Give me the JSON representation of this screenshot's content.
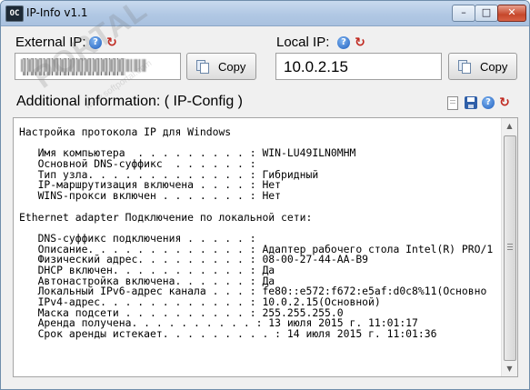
{
  "window": {
    "title": "IP-Info v1.1",
    "app_icon_text": "OC",
    "controls": {
      "minimize": "–",
      "maximize": "□",
      "close": "✕"
    }
  },
  "external_ip": {
    "label": "External IP:",
    "value": "●●●●●●●●●●●",
    "copy_label": "Copy"
  },
  "local_ip": {
    "label": "Local IP:",
    "value": "10.0.2.15",
    "copy_label": "Copy"
  },
  "additional": {
    "title": "Additional information: ( IP-Config )"
  },
  "icons": {
    "help": "?",
    "refresh": "↻"
  },
  "watermark": {
    "text": "PORTAL",
    "url": "www.softportal.com"
  },
  "output_lines": [
    "Настройка протокола IP для Windows",
    "",
    "   Имя компьютера  . . . . . . . . . : WIN-LU49ILN0MHM",
    "   Основной DNS-суффикс  . . . . . . :",
    "   Тип узла. . . . . . . . . . . . . : Гибридный",
    "   IP-маршрутизация включена . . . . : Нет",
    "   WINS-прокси включен . . . . . . . : Нет",
    "",
    "Ethernet adapter Подключение по локальной сети:",
    "",
    "   DNS-суффикс подключения . . . . . :",
    "   Описание. . . . . . . . . . . . . : Адаптер рабочего стола Intel(R) PRO/1",
    "   Физический адрес. . . . . . . . . : 08-00-27-44-AA-B9",
    "   DHCP включен. . . . . . . . . . . : Да",
    "   Автонастройка включена. . . . . . : Да",
    "   Локальный IPv6-адрес канала . . . : fe80::e572:f672:e5af:d0c8%11(Основно",
    "   IPv4-адрес. . . . . . . . . . . . : 10.0.2.15(Основной)",
    "   Маска подсети . . . . . . . . . . : 255.255.255.0",
    "   Аренда получена. . . . . . . . . . : 13 июля 2015 г. 11:01:17",
    "   Срок аренды истекает. . . . . . . . . : 14 июля 2015 г. 11:01:36"
  ]
}
